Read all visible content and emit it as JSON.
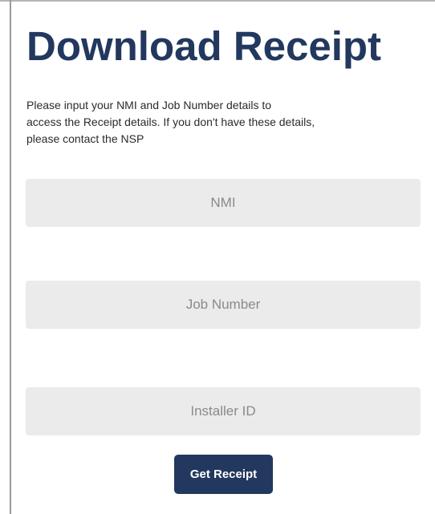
{
  "page": {
    "title": "Download Receipt",
    "intro_line1": "Please input your NMI and Job Number details to",
    "intro_line2": "access the Receipt details. If you don't have these details,",
    "intro_line3": "please contact the NSP"
  },
  "form": {
    "nmi": {
      "placeholder": "NMI",
      "value": ""
    },
    "job_number": {
      "placeholder": "Job Number",
      "value": ""
    },
    "installer_id": {
      "placeholder": "Installer ID",
      "value": ""
    },
    "submit_label": "Get Receipt"
  },
  "colors": {
    "accent": "#22385e",
    "field_background": "#ebebeb",
    "body_text": "#2b2b2b",
    "placeholder_text": "#8a8a8a"
  }
}
